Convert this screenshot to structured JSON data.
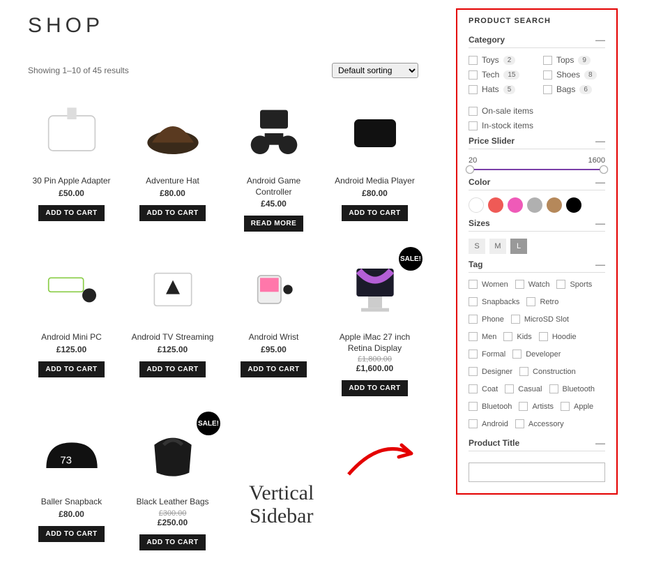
{
  "page": {
    "title": "SHOP",
    "results": "Showing 1–10 of 45 results",
    "sortLabel": "Default sorting"
  },
  "buttons": {
    "add": "ADD TO CART",
    "read": "READ MORE",
    "sale": "SALE!"
  },
  "products": [
    {
      "title": "30 Pin Apple Adapter",
      "price": "£50.00",
      "btn": "add"
    },
    {
      "title": "Adventure Hat",
      "price": "£80.00",
      "btn": "add"
    },
    {
      "title": "Android Game Controller",
      "price": "£45.00",
      "btn": "read"
    },
    {
      "title": "Android Media Player",
      "price": "£80.00",
      "btn": "add"
    },
    {
      "title": "Android Mini PC",
      "price": "£125.00",
      "btn": "add"
    },
    {
      "title": "Android TV Streaming",
      "price": "£125.00",
      "btn": "add"
    },
    {
      "title": "Android Wrist",
      "price": "£95.00",
      "btn": "add"
    },
    {
      "title": "Apple iMac 27 inch Retina Display",
      "price": "£1,600.00",
      "old": "£1,800.00",
      "btn": "add",
      "sale": true
    },
    {
      "title": "Baller Snapback",
      "price": "£80.00",
      "btn": "add"
    },
    {
      "title": "Black Leather Bags",
      "price": "£250.00",
      "old": "£300.00",
      "btn": "add",
      "sale": true
    }
  ],
  "sidebar": {
    "title": "PRODUCT SEARCH",
    "sections": {
      "category": "Category",
      "price": "Price Slider",
      "color": "Color",
      "sizes": "Sizes",
      "tag": "Tag",
      "ptitle": "Product Title"
    },
    "categoriesLeft": [
      {
        "label": "Toys",
        "count": "2"
      },
      {
        "label": "Tech",
        "count": "15"
      },
      {
        "label": "Hats",
        "count": "5"
      }
    ],
    "categoriesRight": [
      {
        "label": "Tops",
        "count": "9"
      },
      {
        "label": "Shoes",
        "count": "8"
      },
      {
        "label": "Bags",
        "count": "6"
      }
    ],
    "misc": [
      {
        "label": "On-sale items"
      },
      {
        "label": "In-stock items"
      }
    ],
    "priceMin": "20",
    "priceMax": "1600",
    "colors": [
      "#ffffff",
      "#ef5a56",
      "#ef5ab8",
      "#b0b0b0",
      "#b5885a",
      "#000000"
    ],
    "sizes": [
      "S",
      "M",
      "L"
    ],
    "sizeSelected": "L",
    "tags": [
      "Women",
      "Watch",
      "Sports",
      "Snapbacks",
      "Retro",
      "Phone",
      "MicroSD Slot",
      "Men",
      "Kids",
      "Hoodie",
      "Formal",
      "Developer",
      "Designer",
      "Construction",
      "Coat",
      "Casual",
      "Bluetooth",
      "Bluetooh",
      "Artists",
      "Apple",
      "Android",
      "Accessory"
    ],
    "titlePlaceholder": ""
  },
  "annotation": {
    "label": "Vertical\nSidebar"
  }
}
